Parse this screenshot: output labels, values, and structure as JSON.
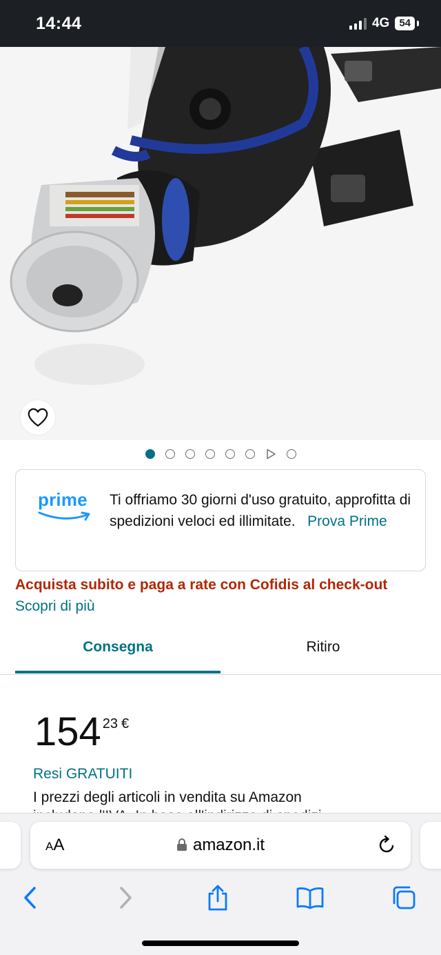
{
  "status_bar": {
    "time": "14:44",
    "network": "4G",
    "battery": "54"
  },
  "product": {
    "image_alt": "gas mask",
    "carousel": {
      "total": 8,
      "active_index": 0
    }
  },
  "prime": {
    "logo": "prime",
    "message": "Ti offriamo 30 giorni d'uso gratuito, approfitta di spedizioni veloci ed illimitate.",
    "link": "Prova Prime"
  },
  "financing": {
    "headline": "Acquista subito e paga a rate con Cofidis al check-out",
    "link": "Scopri di più"
  },
  "tabs": [
    {
      "label": "Consegna",
      "selected": true
    },
    {
      "label": "Ritiro",
      "selected": false
    }
  ],
  "price": {
    "whole": "154",
    "fraction": "23",
    "currency": "€"
  },
  "returns": "Resi GRATUITI",
  "price_note": "I prezzi degli articoli in vendita su Amazon",
  "price_note_cut": "includono l'IVA. In base all'indirizzo di spedizi",
  "browser": {
    "text_size": "AA",
    "url": "amazon.it"
  },
  "colors": {
    "accent": "#007185",
    "prime": "#1a98ff",
    "deal": "#b12704",
    "safari_blue": "#0a7aff"
  }
}
